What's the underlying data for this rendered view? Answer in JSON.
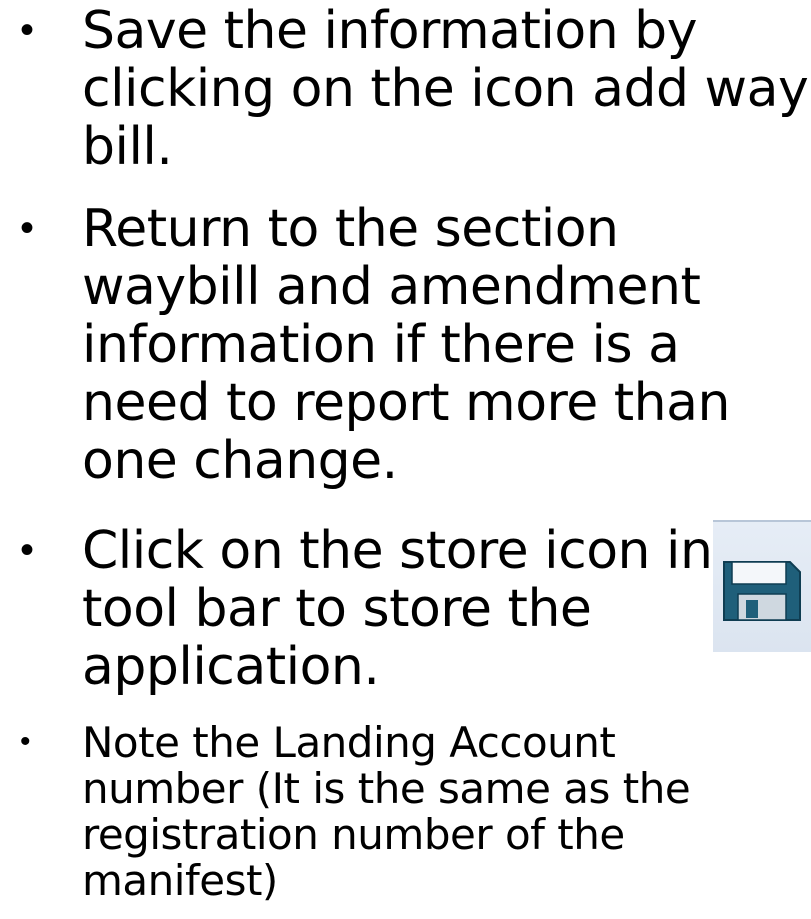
{
  "bullets": [
    {
      "symbol": "•",
      "text": "Save the information by\nclicking on the icon add way\nbill."
    },
    {
      "symbol": "•",
      "text": "Return to the section\nwaybill and amendment\ninformation if there is a\nneed to report more than\none change."
    },
    {
      "symbol": "•",
      "text": "Click on the store icon in\ntool bar to store the\napplication."
    },
    {
      "symbol": "•",
      "text": "Note the Landing Account\nnumber (It is the same as the\nregistration number of the\nmanifest)"
    }
  ],
  "icons": {
    "store_icon": "floppy-disk-icon"
  },
  "colors": {
    "text": "#000000",
    "background": "#ffffff",
    "icon_background": "#dbe4f0",
    "icon_body": "#1f5f7a"
  }
}
